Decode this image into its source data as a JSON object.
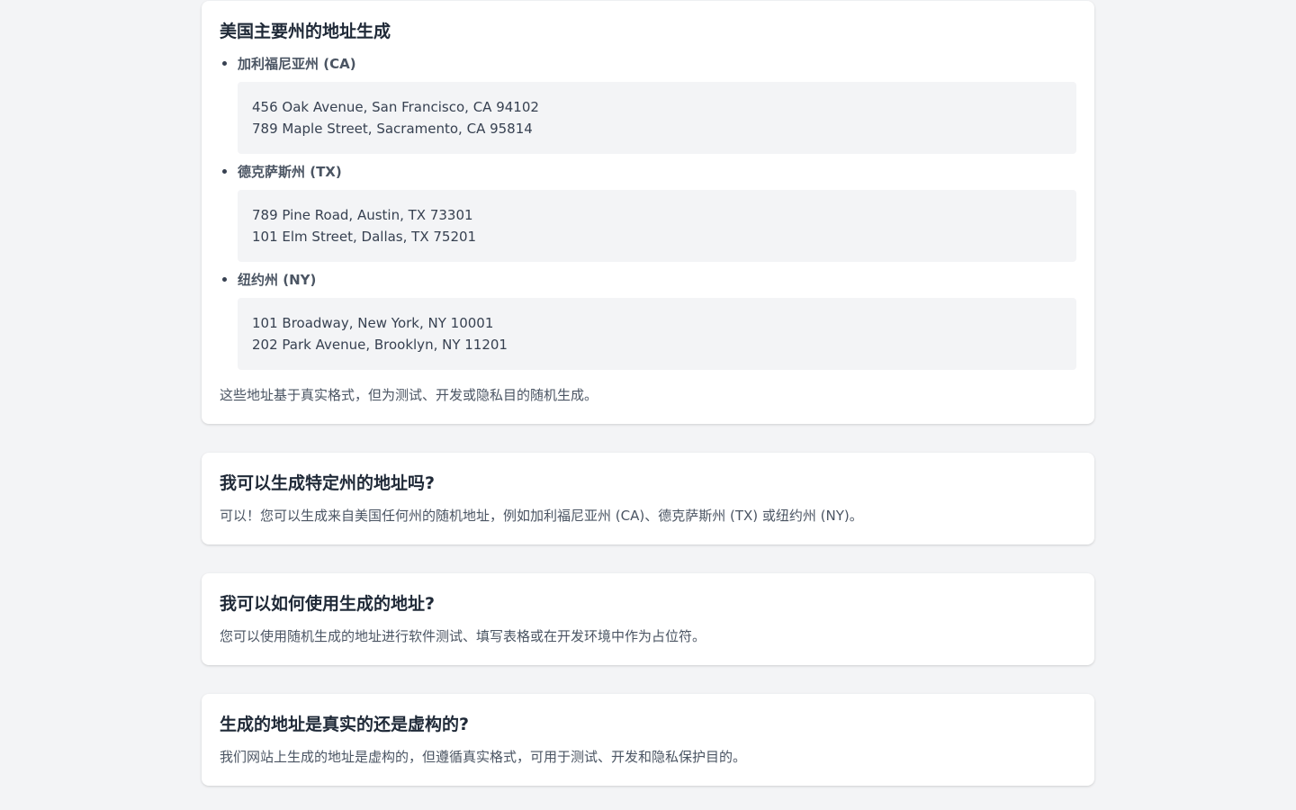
{
  "main_card": {
    "title": "美国主要州的地址生成",
    "states": [
      {
        "name": "加利福尼亚州 (CA)",
        "addresses": [
          "456 Oak Avenue, San Francisco, CA 94102",
          "789 Maple Street, Sacramento, CA 95814"
        ]
      },
      {
        "name": "德克萨斯州 (TX)",
        "addresses": [
          "789 Pine Road, Austin, TX 73301",
          "101 Elm Street, Dallas, TX 75201"
        ]
      },
      {
        "name": "纽约州 (NY)",
        "addresses": [
          "101 Broadway, New York, NY 10001",
          "202 Park Avenue, Brooklyn, NY 11201"
        ]
      }
    ],
    "note": "这些地址基于真实格式，但为测试、开发或隐私目的随机生成。"
  },
  "faq": [
    {
      "question": "我可以生成特定州的地址吗?",
      "answer": "可以！您可以生成来自美国任何州的随机地址，例如加利福尼亚州 (CA)、德克萨斯州 (TX) 或纽约州 (NY)。"
    },
    {
      "question": "我可以如何使用生成的地址?",
      "answer": "您可以使用随机生成的地址进行软件测试、填写表格或在开发环境中作为占位符。"
    },
    {
      "question": "生成的地址是真实的还是虚构的?",
      "answer": "我们网站上生成的地址是虚构的，但遵循真实格式，可用于测试、开发和隐私保护目的。"
    }
  ],
  "colors": {
    "background": "#f3f4f6",
    "card": "#ffffff",
    "heading": "#1f2937",
    "text": "#4b5563",
    "address_box": "#f3f4f6"
  }
}
